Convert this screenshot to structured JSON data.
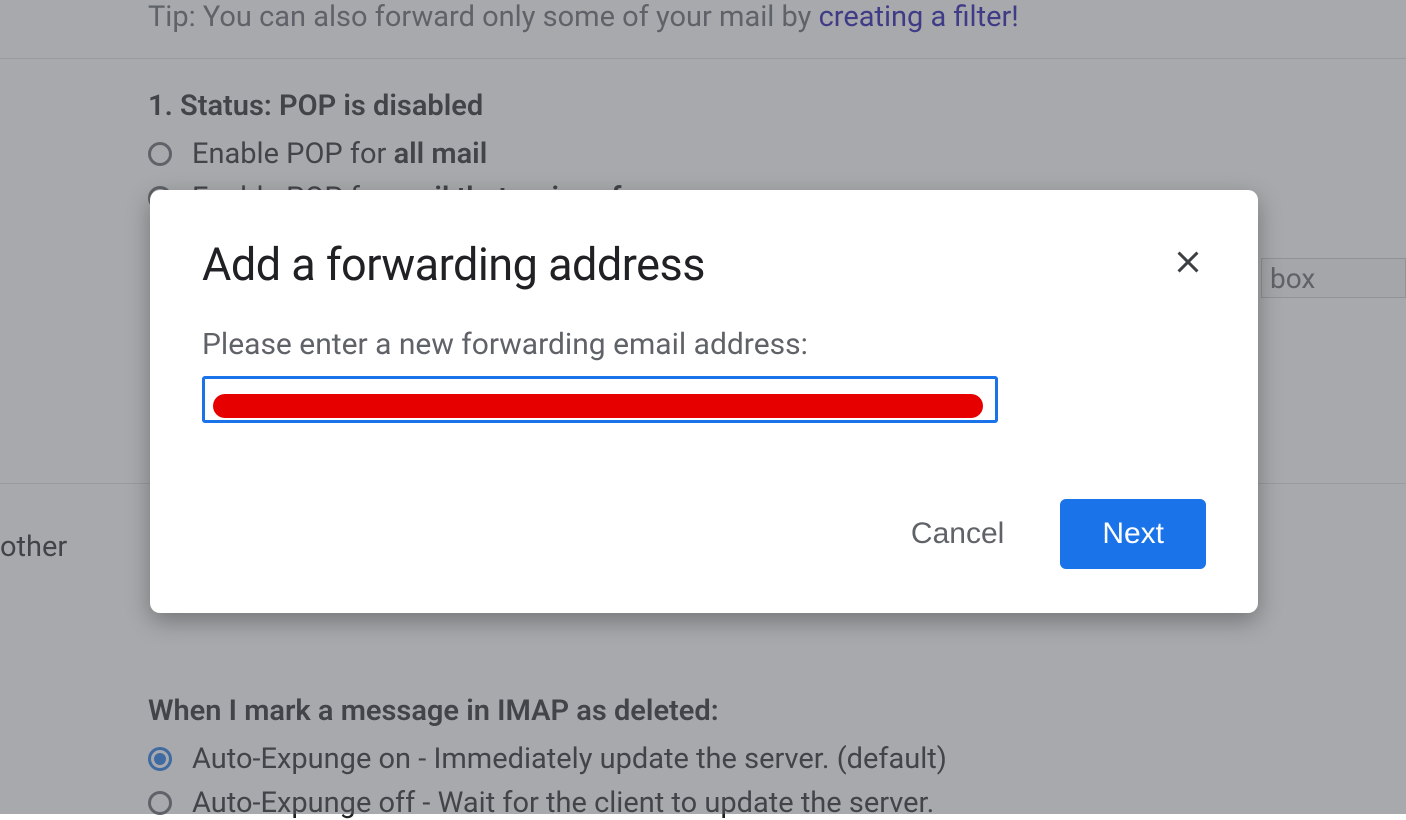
{
  "background": {
    "tip_prefix": "Tip: You can also forward only some of your mail by ",
    "tip_link": "creating a filter!",
    "pop": {
      "title_prefix": "1. Status: ",
      "title_status": "POP is disabled",
      "option1_prefix": "Enable POP for ",
      "option1_bold": "all mail",
      "option2_prefix": "Enable POP for ",
      "option2_bold": "mail that arrives from now on"
    },
    "other_label": "other",
    "dropdown_text": "box",
    "imap": {
      "title": "When I mark a message in IMAP as deleted:",
      "option1": "Auto-Expunge on - Immediately update the server. (default)",
      "option2": "Auto-Expunge off - Wait for the client to update the server."
    }
  },
  "modal": {
    "title": "Add a forwarding address",
    "prompt": "Please enter a new forwarding email address:",
    "input_value": "",
    "cancel_label": "Cancel",
    "next_label": "Next"
  }
}
